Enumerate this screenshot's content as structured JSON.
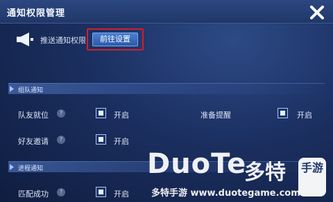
{
  "window": {
    "title": "通知权限管理"
  },
  "push": {
    "label": "推送通知权限",
    "goto_button": "前往设置"
  },
  "sections": [
    {
      "title": "组队通知",
      "options": [
        {
          "name": "队友就位",
          "state": "开启"
        },
        {
          "name": "准备提醒",
          "state": "开启"
        },
        {
          "name": "好友邀请",
          "state": "开启"
        }
      ]
    },
    {
      "title": "进程通知",
      "options": [
        {
          "name": "匹配成功",
          "state": "开启"
        }
      ]
    }
  ],
  "help_glyph": "?",
  "icons": {
    "close": "close-icon",
    "speaker": "megaphone-icon"
  },
  "colors": {
    "highlight_box": "#d21f28",
    "button": "#3b6cbc"
  },
  "watermark": {
    "brand": "DuoTe",
    "cn": "多特",
    "badge": "手游",
    "site": "多特手游 www.duotegame.com"
  }
}
